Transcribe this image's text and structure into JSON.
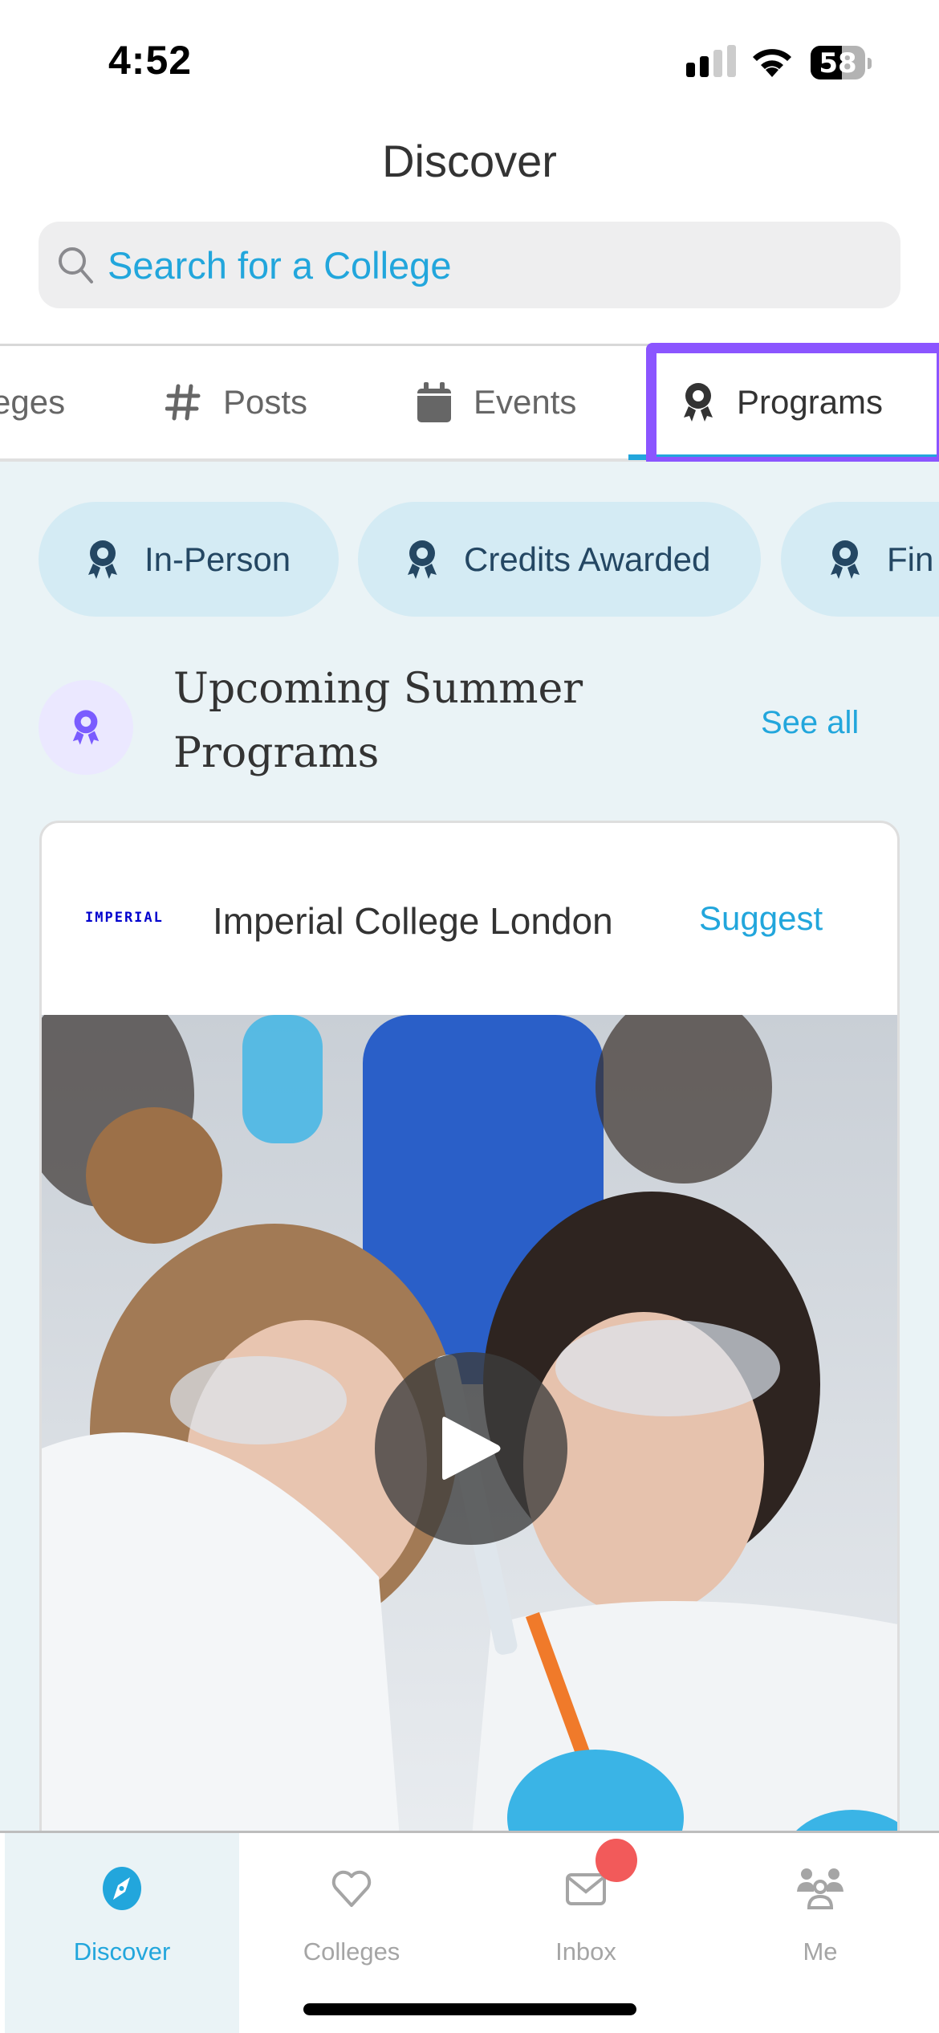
{
  "status_bar": {
    "time": "4:52",
    "signal_bars_active": 2,
    "signal_bars_total": 4,
    "wifi_icon": "wifi-icon",
    "battery_percent": 58
  },
  "header": {
    "title": "Discover",
    "search": {
      "placeholder": "Search for a College",
      "value": "",
      "icon": "search-icon"
    }
  },
  "tabs": [
    {
      "label": "Colleges",
      "visible_text": "eges",
      "icon": "school-icon",
      "active": false
    },
    {
      "label": "Posts",
      "icon": "hashtag-icon",
      "active": false
    },
    {
      "label": "Events",
      "icon": "calendar-icon",
      "active": false
    },
    {
      "label": "Programs",
      "icon": "award-icon",
      "active": true
    }
  ],
  "filter_chips": [
    {
      "label": "In-Person",
      "icon": "award-icon"
    },
    {
      "label": "Credits Awarded",
      "icon": "award-icon"
    },
    {
      "label": "Fin",
      "icon": "award-icon"
    }
  ],
  "section": {
    "title": "Upcoming Summer Programs",
    "title_line1": "Upcoming Summer",
    "title_line2": "Programs",
    "see_all": "See all",
    "icon": "award-icon"
  },
  "program_card": {
    "college_logo_text": "IMPERIAL",
    "college_name": "Imperial College London",
    "suggest_label": "Suggest",
    "media": "video-thumbnail",
    "play_icon": "play-icon"
  },
  "bottom_nav": [
    {
      "label": "Discover",
      "icon": "compass-icon",
      "active": true
    },
    {
      "label": "Colleges",
      "icon": "heart-icon",
      "active": false
    },
    {
      "label": "Inbox",
      "icon": "mail-icon",
      "active": false,
      "badge": true
    },
    {
      "label": "Me",
      "icon": "people-icon",
      "active": false
    }
  ],
  "colors": {
    "accent": "#22a6dc",
    "highlight": "#8b55ff",
    "chip_bg": "#d4ebf4",
    "chip_text": "#244763",
    "section_icon": "#7a5cff",
    "section_icon_bg": "#ebe8ff",
    "badge": "#f25a5a",
    "content_bg": "#eaf3f6"
  }
}
